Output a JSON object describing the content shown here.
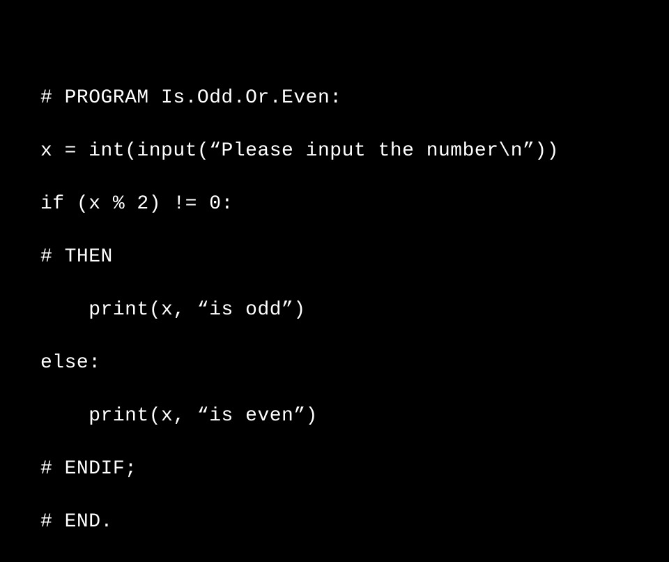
{
  "code": {
    "line1": "# PROGRAM Is.Odd.Or.Even:",
    "line2": "x = int(input(“Please input the number\\n”))",
    "line3": "if (x % 2) != 0:",
    "line4": "# THEN",
    "line5": "    print(x, “is odd”)",
    "line6": "else:",
    "line7": "    print(x, “is even”)",
    "line8": "# ENDIF;",
    "line9": "# END."
  }
}
